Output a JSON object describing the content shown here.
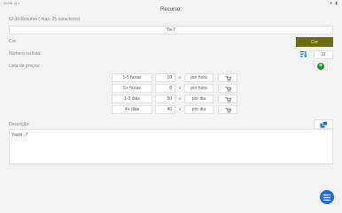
{
  "status_bar": {
    "time": "20:00",
    "icons": "◍ ▪",
    "right_icons": "▾ ▮"
  },
  "page": {
    "title": "Recurso:"
  },
  "resource_id": {
    "label": "ID do Recurso ( max. 25 caracteres)",
    "value": "Ya-7"
  },
  "color": {
    "label": "Cor:",
    "button_label": "Cor",
    "button_color": "#6b6b1c"
  },
  "list_number": {
    "label": "Número na lista:",
    "value": "31",
    "icon": "sort-icon"
  },
  "price_list": {
    "label": "Lista de preços:",
    "add_icon": "plus-icon",
    "currency": "€",
    "cart_icon": "cart-icon",
    "rows": [
      {
        "period": "1-5 horas",
        "price": "10",
        "unit": "por hora"
      },
      {
        "period": "5+ horas",
        "price": "8",
        "unit": "por hora"
      },
      {
        "period": "1-3 dias",
        "price": "50",
        "unit": "por dia"
      },
      {
        "period": "4+ dias",
        "price": "40",
        "unit": "por dia"
      }
    ]
  },
  "description": {
    "label": "Descrição:",
    "value": "Yacht -7",
    "copy_icon": "copy-icon"
  },
  "fab": {
    "icon": "menu-icon",
    "color": "#1d6fd3"
  }
}
